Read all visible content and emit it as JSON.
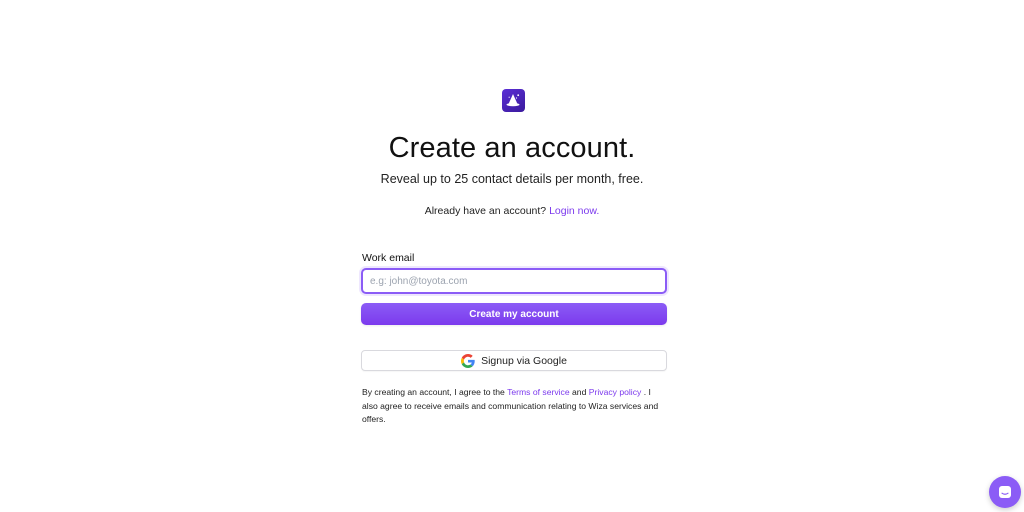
{
  "brand": {
    "logo_icon": "wizard-hat-icon",
    "accent_color": "#7c3aed",
    "logo_color": "#4c1fbf"
  },
  "header": {
    "title": "Create an account.",
    "subtitle": "Reveal up to 25 contact details per month, free."
  },
  "login": {
    "prompt": "Already have an account?",
    "link_label": "Login now."
  },
  "form": {
    "email_label": "Work email",
    "email_placeholder": "e.g: john@toyota.com",
    "email_value": "",
    "submit_label": "Create my account"
  },
  "google": {
    "icon": "google-g-icon",
    "label": "Signup via Google"
  },
  "terms": {
    "prefix": "By creating an account, I agree to the",
    "terms_link": "Terms of service",
    "and": "and",
    "privacy_link": "Privacy policy",
    "suffix": ". I also agree to receive emails and communication relating to Wiza services and offers."
  },
  "chat": {
    "icon": "chat-icon"
  }
}
